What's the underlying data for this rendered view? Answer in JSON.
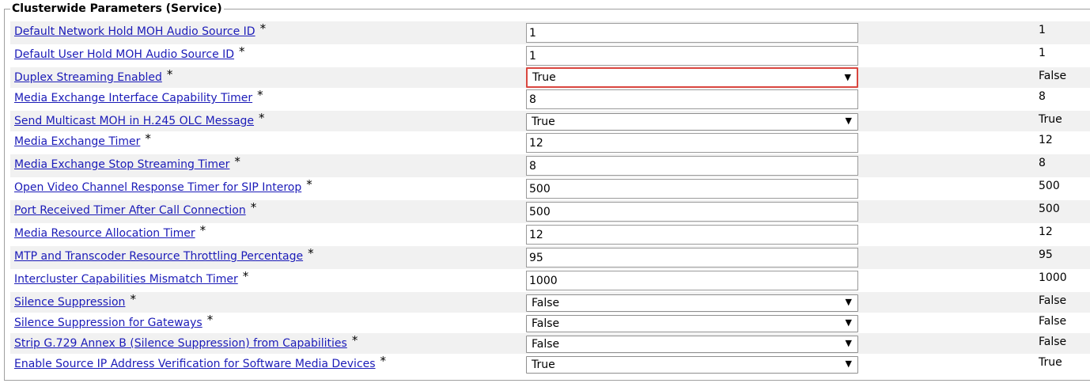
{
  "section": {
    "title": "Clusterwide Parameters (Service)"
  },
  "required_mark": "*",
  "rows": [
    {
      "label": "Default Network Hold MOH Audio Source ID",
      "value": "1",
      "default": "1"
    },
    {
      "label": "Default User Hold MOH Audio Source ID",
      "value": "1",
      "default": "1"
    },
    {
      "label": "Duplex Streaming Enabled",
      "value": "True",
      "default": "False"
    },
    {
      "label": "Media Exchange Interface Capability Timer",
      "value": "8",
      "default": "8"
    },
    {
      "label": "Send Multicast MOH in H.245 OLC Message",
      "value": "True",
      "default": "True"
    },
    {
      "label": "Media Exchange Timer",
      "value": "12",
      "default": "12"
    },
    {
      "label": "Media Exchange Stop Streaming Timer",
      "value": "8",
      "default": "8"
    },
    {
      "label": "Open Video Channel Response Timer for SIP Interop",
      "value": "500",
      "default": "500"
    },
    {
      "label": "Port Received Timer After Call Connection",
      "value": "500",
      "default": "500"
    },
    {
      "label": "Media Resource Allocation Timer",
      "value": "12",
      "default": "12"
    },
    {
      "label": "MTP and Transcoder Resource Throttling Percentage",
      "value": "95",
      "default": "95"
    },
    {
      "label": "Intercluster Capabilities Mismatch Timer",
      "value": "1000",
      "default": "1000"
    },
    {
      "label": "Silence Suppression",
      "value": "False",
      "default": "False"
    },
    {
      "label": "Silence Suppression for Gateways",
      "value": "False",
      "default": "False"
    },
    {
      "label": "Strip G.729 Annex B (Silence Suppression) from Capabilities",
      "value": "False",
      "default": "False"
    },
    {
      "label": "Enable Source IP Address Verification for Software Media Devices",
      "value": "True",
      "default": "True"
    }
  ],
  "icons": {
    "dropdown": "chevron-down-icon"
  },
  "colors": {
    "link": "#1b1bb8",
    "focus_border": "#d9463f",
    "row_shade": "#f1f1f1"
  }
}
